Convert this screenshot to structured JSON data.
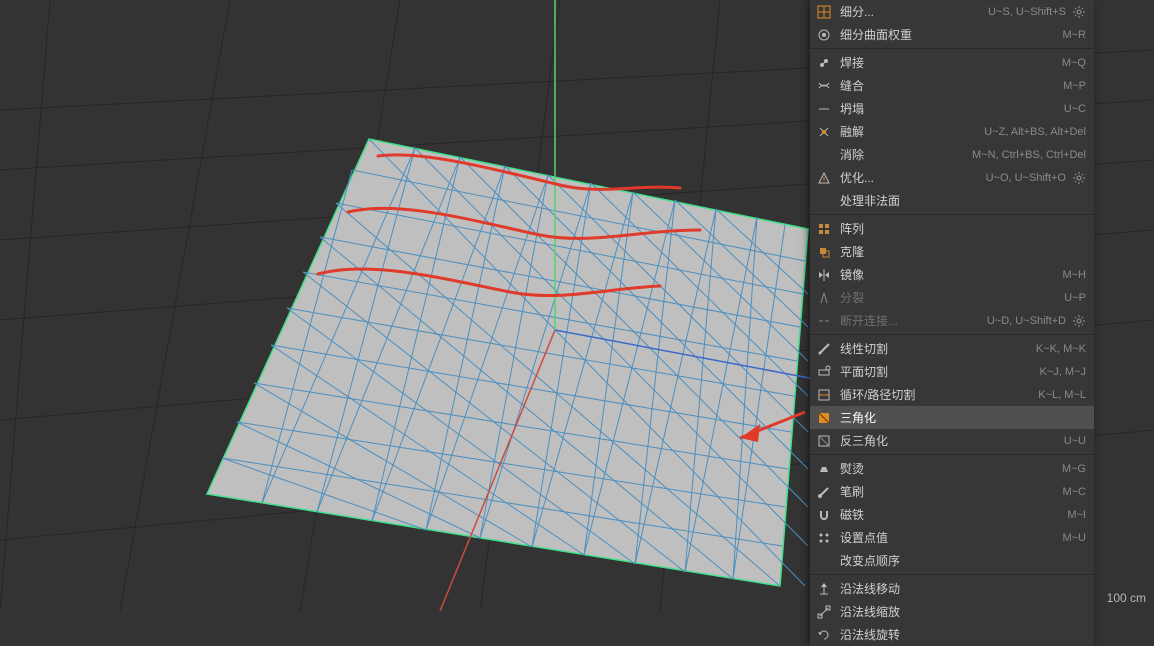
{
  "status": {
    "scale": "100 cm"
  },
  "menu": {
    "items": [
      {
        "icon": "subdivide-icon",
        "label": "细分...",
        "shortcut": "U~S, U~Shift+S",
        "gear": true
      },
      {
        "icon": "subdiv-weight-icon",
        "label": "细分曲面权重",
        "shortcut": "M~R"
      },
      {
        "sep": true
      },
      {
        "icon": "weld-icon",
        "label": "焊接",
        "shortcut": "M~Q"
      },
      {
        "icon": "stitch-icon",
        "label": "缝合",
        "shortcut": "M~P"
      },
      {
        "icon": "collapse-icon",
        "label": "坍塌",
        "shortcut": "U~C"
      },
      {
        "icon": "dissolve-icon",
        "label": "融解",
        "shortcut": "U~Z, Alt+BS, Alt+Del"
      },
      {
        "icon": "blank-icon",
        "label": "消除",
        "shortcut": "M~N, Ctrl+BS, Ctrl+Del"
      },
      {
        "icon": "optimize-icon",
        "label": "优化...",
        "shortcut": "U~O, U~Shift+O",
        "gear": true
      },
      {
        "icon": "blank-icon",
        "label": "处理非法面",
        "shortcut": ""
      },
      {
        "sep": true
      },
      {
        "icon": "array-icon",
        "label": "阵列",
        "shortcut": ""
      },
      {
        "icon": "clone-icon",
        "label": "克隆",
        "shortcut": ""
      },
      {
        "icon": "mirror-icon",
        "label": "镜像",
        "shortcut": "M~H"
      },
      {
        "icon": "split-icon",
        "label": "分裂",
        "shortcut": "U~P",
        "disabled": true
      },
      {
        "icon": "disconnect-icon",
        "label": "断开连接...",
        "shortcut": "U~D, U~Shift+D",
        "gear": true,
        "disabled": true
      },
      {
        "sep": true
      },
      {
        "icon": "line-cut-icon",
        "label": "线性切割",
        "shortcut": "K~K, M~K"
      },
      {
        "icon": "plane-cut-icon",
        "label": "平面切割",
        "shortcut": "K~J, M~J"
      },
      {
        "icon": "loop-cut-icon",
        "label": "循环/路径切割",
        "shortcut": "K~L, M~L"
      },
      {
        "icon": "triangulate-icon",
        "label": "三角化",
        "shortcut": "",
        "selected": true
      },
      {
        "icon": "untriangulate-icon",
        "label": "反三角化",
        "shortcut": "U~U"
      },
      {
        "sep": true
      },
      {
        "icon": "iron-icon",
        "label": "熨烫",
        "shortcut": "M~G"
      },
      {
        "icon": "brush-icon",
        "label": "笔刷",
        "shortcut": "M~C"
      },
      {
        "icon": "magnet-icon",
        "label": "磁铁",
        "shortcut": "M~I"
      },
      {
        "icon": "set-point-icon",
        "label": "设置点值",
        "shortcut": "M~U"
      },
      {
        "icon": "blank-icon",
        "label": "改变点顺序",
        "shortcut": ""
      },
      {
        "sep": true
      },
      {
        "icon": "normal-move-icon",
        "label": "沿法线移动",
        "shortcut": ""
      },
      {
        "icon": "normal-scale-icon",
        "label": "沿法线缩放",
        "shortcut": ""
      },
      {
        "icon": "normal-rotate-icon",
        "label": "沿法线旋转",
        "shortcut": ""
      }
    ]
  },
  "colors": {
    "accent": "#e38b1e",
    "edge": "#4c8fbf",
    "sel_edge": "#3fe08a",
    "annot": "#e03a2a"
  }
}
